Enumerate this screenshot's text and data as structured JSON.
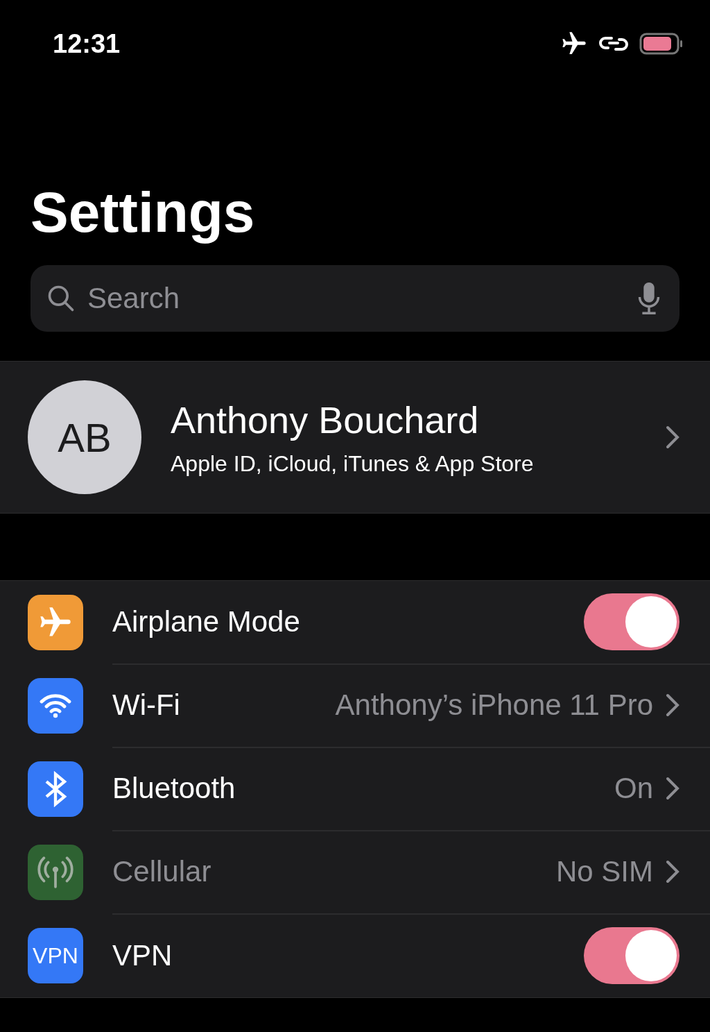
{
  "status_bar": {
    "time": "12:31",
    "airplane": true
  },
  "title": "Settings",
  "search": {
    "placeholder": "Search"
  },
  "profile": {
    "initials": "AB",
    "name": "Anthony Bouchard",
    "subtitle": "Apple ID, iCloud, iTunes & App Store"
  },
  "rows": [
    {
      "kind": "toggle",
      "color": "#f09a37",
      "label": "Airplane Mode",
      "on": true,
      "disabled": false
    },
    {
      "kind": "link",
      "color": "#3478f6",
      "label": "Wi-Fi",
      "value": "Anthony’s iPhone 11 Pro",
      "disabled": false
    },
    {
      "kind": "link",
      "color": "#3478f6",
      "label": "Bluetooth",
      "value": "On",
      "disabled": false
    },
    {
      "kind": "link",
      "color": "#3a7a3f",
      "label": "Cellular",
      "value": "No SIM",
      "disabled": true
    },
    {
      "kind": "toggle",
      "icon_text": "VPN",
      "color": "#3478f6",
      "label": "VPN",
      "on": true,
      "disabled": false
    }
  ]
}
